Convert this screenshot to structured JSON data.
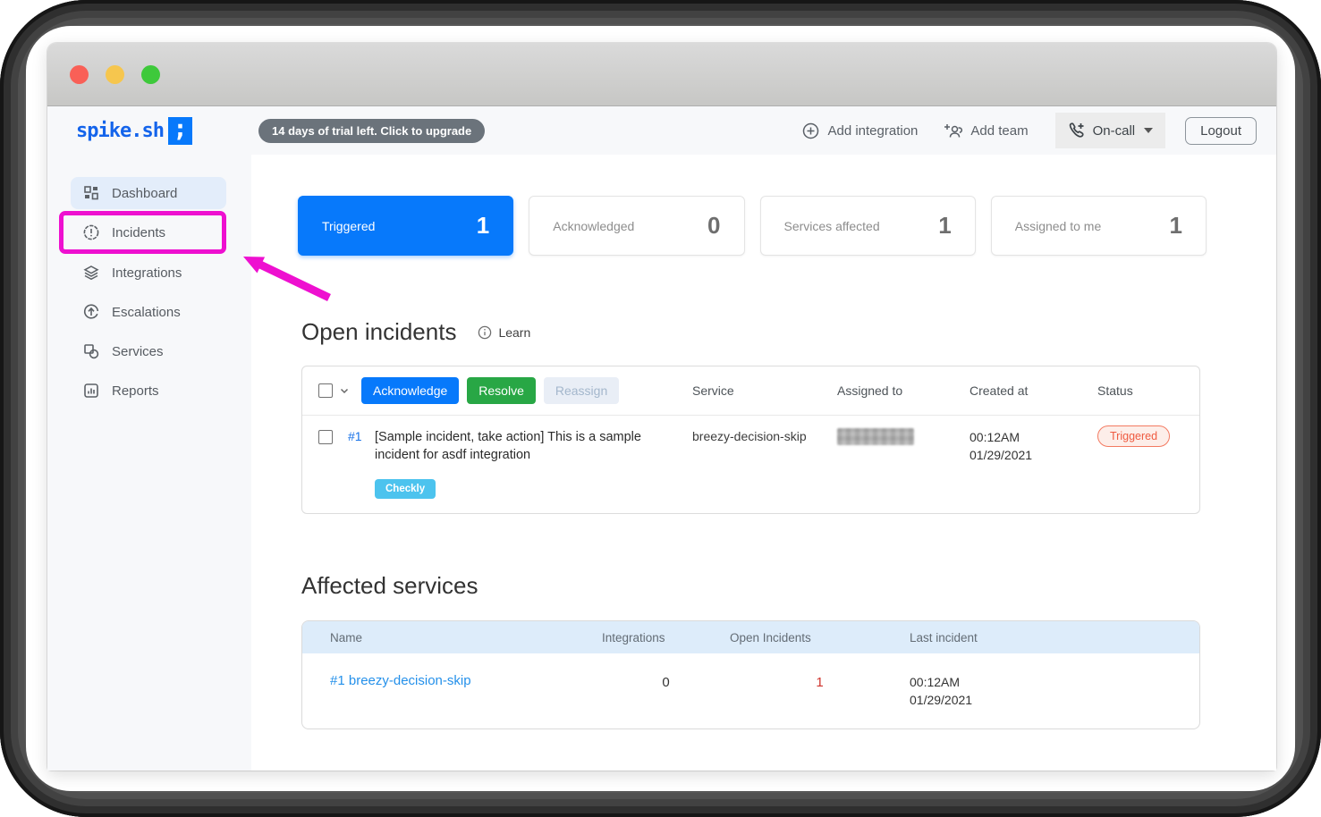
{
  "colors": {
    "primary_blue": "#0779fb",
    "resolve_green": "#28a745",
    "checkly_badge": "#4cc3ee",
    "triggered_color": "#ef5b41",
    "annotation_magenta": "#ee10d0",
    "link_blue": "#2490ea",
    "open_red": "#cf342d"
  },
  "window": {
    "traffic_lights": [
      "close",
      "minimize",
      "zoom"
    ]
  },
  "header": {
    "logo_text": "spike.sh",
    "logo_glyph": ";",
    "trial_badge": "14 days of trial left. Click to upgrade",
    "actions": {
      "add_integration": "Add integration",
      "add_team": "Add team",
      "on_call": "On-call",
      "logout": "Logout"
    }
  },
  "sidebar": {
    "items": [
      {
        "label": "Dashboard",
        "icon": "dashboard-grid-icon",
        "active": true
      },
      {
        "label": "Incidents",
        "icon": "incident-badge-icon",
        "active": false
      },
      {
        "label": "Integrations",
        "icon": "layers-icon",
        "active": false
      },
      {
        "label": "Escalations",
        "icon": "escalation-up-arrow-icon",
        "active": false
      },
      {
        "label": "Services",
        "icon": "shapes-icon",
        "active": false
      },
      {
        "label": "Reports",
        "icon": "bar-chart-icon",
        "active": false
      }
    ]
  },
  "stats": [
    {
      "label": "Triggered",
      "value": "1",
      "variant": "primary"
    },
    {
      "label": "Acknowledged",
      "value": "0",
      "variant": "default"
    },
    {
      "label": "Services affected",
      "value": "1",
      "variant": "default"
    },
    {
      "label": "Assigned to me",
      "value": "1",
      "variant": "default"
    }
  ],
  "open_incidents": {
    "title": "Open incidents",
    "learn_label": "Learn",
    "bulk_actions": {
      "acknowledge": "Acknowledge",
      "resolve": "Resolve",
      "reassign": "Reassign"
    },
    "columns": [
      "Service",
      "Assigned to",
      "Created at",
      "Status"
    ],
    "rows": [
      {
        "id": "#1",
        "title": "[Sample incident, take action] This is a sample incident for asdf integration",
        "integration_badge": "Checkly",
        "service": "breezy-decision-skip",
        "assigned_to_redacted": true,
        "created_time": "00:12AM",
        "created_date": "01/29/2021",
        "status": "Triggered"
      }
    ]
  },
  "affected_services": {
    "title": "Affected services",
    "columns": [
      "Name",
      "Integrations",
      "Open Incidents",
      "Last incident"
    ],
    "rows": [
      {
        "name": "#1 breezy-decision-skip",
        "integrations": "0",
        "open_incidents": "1",
        "last_incident_time": "00:12AM",
        "last_incident_date": "01/29/2021"
      }
    ]
  },
  "annotation": {
    "highlighted_item": "Incidents",
    "shape": "box-with-arrow"
  }
}
